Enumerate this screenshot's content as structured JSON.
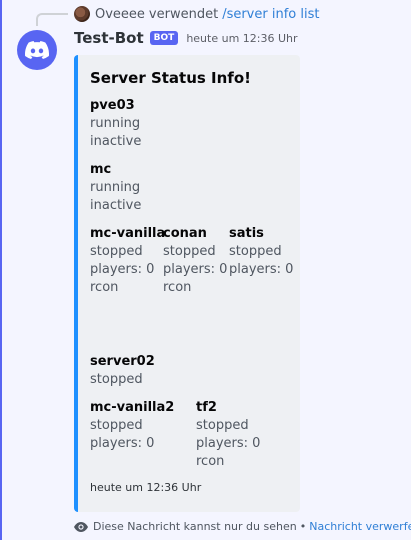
{
  "reply": {
    "user": "Oveeee",
    "verb": "verwendet",
    "command": "/server info list"
  },
  "message": {
    "author": "Test-Bot",
    "badge": "BOT",
    "timestamp": "heute um 12:36 Uhr"
  },
  "embed": {
    "accent_color": "#1e90ff",
    "title": "Server Status Info!",
    "fields": [
      {
        "name": "pve03",
        "lines": [
          "running",
          "inactive"
        ]
      },
      {
        "name": "mc",
        "lines": [
          "running",
          "inactive"
        ]
      },
      {
        "name": "mc-vanilla",
        "lines": [
          "stopped",
          "players: 0",
          "rcon"
        ]
      },
      {
        "name": "conan",
        "lines": [
          "stopped",
          "players: 0",
          "rcon"
        ]
      },
      {
        "name": "satis",
        "lines": [
          "stopped",
          "players: 0"
        ]
      },
      {
        "name": "server02",
        "lines": [
          "stopped"
        ]
      },
      {
        "name": "mc-vanilla2",
        "lines": [
          "stopped",
          "players: 0"
        ]
      },
      {
        "name": "tf2",
        "lines": [
          "stopped",
          "players: 0",
          "rcon"
        ]
      }
    ],
    "footer": "heute um 12:36 Uhr"
  },
  "ephemeral": {
    "notice": "Diese Nachricht kannst nur du sehen",
    "separator": "•",
    "dismiss": "Nachricht verwerfen"
  },
  "colors": {
    "blurple": "#5865f2",
    "link": "#2f7fd6"
  },
  "icons": {
    "avatar": "discord-logo-icon",
    "reply_avatar": "user-avatar",
    "ephemeral": "eye-icon"
  }
}
